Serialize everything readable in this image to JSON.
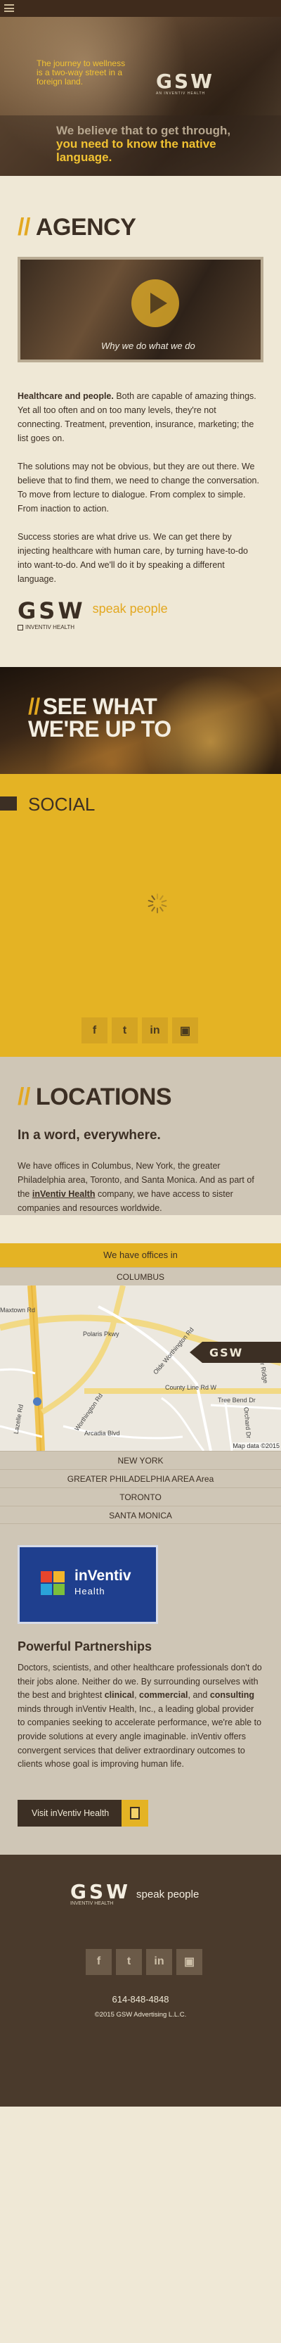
{
  "nav": {
    "menu_icon": "hamburger-menu-icon"
  },
  "hero": {
    "tagline": "The journey to wellness is a two-way street in a foreign land.",
    "logo": "GSW",
    "logo_sub": "AN INVENTIV HEALTH",
    "headline_plain": "We believe that to get through, ",
    "headline_highlight": "you need to know the native language."
  },
  "agency": {
    "title": "AGENCY",
    "video_caption": "Why we do what we do",
    "p1_bold": "Healthcare and people.",
    "p1_rest": " Both are capable of amazing things. Yet all too often and on too many levels, they're not connecting. Treatment, prevention, insurance, marketing; the list goes on.",
    "p2": "The solutions may not be obvious, but they are out there. We believe that to find them, we need to change the conversation. To move from lecture to dialogue. From complex to simple. From inaction to action.",
    "p3": "Success stories are what drive us. We can get there by injecting healthcare with human care, by turning have-to-do into want-to-do. And we'll do it by speaking a different language.",
    "logo": "GSW",
    "logo_sub": "INVENTIV HEALTH",
    "slogan": "speak people"
  },
  "see_what": {
    "line1": "SEE WHAT",
    "line2": "WE'RE UP TO"
  },
  "social": {
    "title": "SOCIAL",
    "icons": [
      "f",
      "t",
      "in",
      "▣"
    ]
  },
  "locations": {
    "title": "LOCATIONS",
    "subtitle": "In a word, everywhere.",
    "body_pre": "We have offices in Columbus, New York, the greater Philadelphia area, Toronto, and Santa Monica. And as part of the ",
    "body_link": "inVentiv Health",
    "body_post": " company, we have access to sister companies and resources worldwide.",
    "offices_label": "We have offices in",
    "active_city": "COLUMBUS",
    "cities": [
      "NEW YORK",
      "GREATER PHILADELPHIA AREA Area",
      "TORONTO",
      "SANTA MONICA"
    ],
    "map": {
      "labels": [
        "Polaris Pkwy",
        "Olde Worthington Rd",
        "County Line Rd W",
        "Worthington Rd",
        "Tree Bend Dr",
        "Arcadia Blvd",
        "Lazelle Rd",
        "Taylor Ridge Dr",
        "Orchard Dr",
        "Maxtown Rd"
      ],
      "badge": "GSW",
      "credit": "Map data ©2015"
    }
  },
  "partners": {
    "logo_text": "inVentiv",
    "logo_sub": "Health",
    "title": "Powerful Partnerships",
    "body_pre": "Doctors, scientists, and other healthcare professionals don't do their jobs alone. Neither do we. By surrounding ourselves with the best and brightest ",
    "body_b1": "clinical",
    "body_mid1": ", ",
    "body_b2": "commercial",
    "body_mid2": ", and ",
    "body_b3": "consulting",
    "body_post": " minds through inVentiv Health, Inc., a leading global provider to companies seeking to accelerate performance, we're able to provide solutions at every angle imaginable. inVentiv offers convergent services that deliver extraordinary outcomes to clients whose goal is improving human life.",
    "cta": "Visit inVentiv Health"
  },
  "footer": {
    "logo": "GSW",
    "logo_sub": "INVENTIV HEALTH",
    "slogan": "speak people",
    "phone": "614-848-4848",
    "copyright": "©2015 GSW Advertising L.L.C."
  },
  "colors": {
    "accent": "#e4b324",
    "brown": "#3c2f24",
    "cream": "#efe8d6",
    "taupe": "#cfc6b6"
  }
}
